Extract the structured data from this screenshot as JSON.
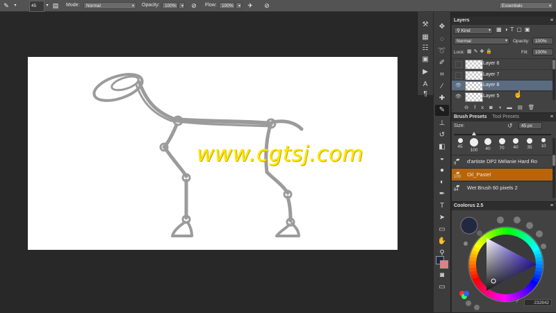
{
  "options_bar": {
    "brush_size": "45",
    "mode_label": "Mode:",
    "mode_value": "Normal",
    "opacity_label": "Opacity:",
    "opacity_value": "100%",
    "flow_label": "Flow:",
    "flow_value": "100%",
    "workspace": "Essentials"
  },
  "canvas": {
    "watermark": "www.cgtsj.com"
  },
  "layers_panel": {
    "title": "Layers",
    "filter_value": "Kind",
    "blend_mode": "Normal",
    "opacity_label": "Opacity:",
    "opacity_value": "100%",
    "lock_label": "Lock:",
    "fill_label": "Fill:",
    "fill_value": "100%",
    "layers": [
      {
        "name": "Layer 6",
        "visible": false,
        "selected": false
      },
      {
        "name": "Layer 7",
        "visible": false,
        "selected": false
      },
      {
        "name": "Layer 8",
        "visible": true,
        "selected": true
      },
      {
        "name": "Layer 5",
        "visible": true,
        "selected": false
      }
    ]
  },
  "brush_panel": {
    "tab_presets": "Brush Presets",
    "tab_tool_presets": "Tool Presets",
    "size_label": "Size:",
    "size_value": "45 px",
    "tip_sizes": [
      "45",
      "100",
      "40",
      "70",
      "40",
      "35",
      "10"
    ],
    "brushes": [
      {
        "size": "9",
        "name": "d'artiste DP2 Mélanie Hard Ro",
        "selected": false
      },
      {
        "size": "100",
        "name": "Oil_Pastel",
        "selected": true
      },
      {
        "size": "64",
        "name": "Wet Brush 60 pixels 2",
        "selected": false
      }
    ]
  },
  "coolorus_panel": {
    "title": "Coolorus 2.5",
    "hex_value": "232842"
  },
  "colors": {
    "foreground": "#232842",
    "background": "#e08080",
    "selection": "#5b6b80",
    "brush_highlight": "#b8650a",
    "watermark": "#ffe600"
  }
}
